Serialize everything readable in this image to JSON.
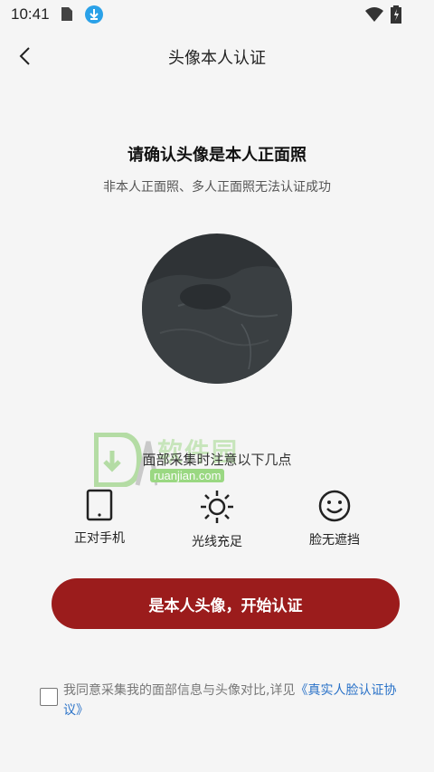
{
  "status_bar": {
    "time": "10:41",
    "icons": [
      "sd-card-icon",
      "download-icon",
      "wifi-icon",
      "battery-icon"
    ]
  },
  "app_bar": {
    "back_icon": "chevron-left-icon",
    "title": "头像本人认证"
  },
  "main": {
    "heading": "请确认头像是本人正面照",
    "subheading": "非本人正面照、多人正面照无法认证成功",
    "notice": "面部采集时注意以下几点",
    "tips": [
      {
        "icon": "phone-icon",
        "label": "正对手机"
      },
      {
        "icon": "sun-icon",
        "label": "光线充足"
      },
      {
        "icon": "smile-icon",
        "label": "脸无遮挡"
      }
    ],
    "cta_label": "是本人头像，开始认证"
  },
  "agreement": {
    "text": "我同意采集我的面部信息与头像对比,详见",
    "link": "《真实人脸认证协议》"
  },
  "watermark": {
    "cn": "软件园",
    "en": "ruanjian.com"
  },
  "colors": {
    "accent": "#9b1c1c",
    "link": "#2a72c8",
    "background": "#f5f5f5"
  }
}
